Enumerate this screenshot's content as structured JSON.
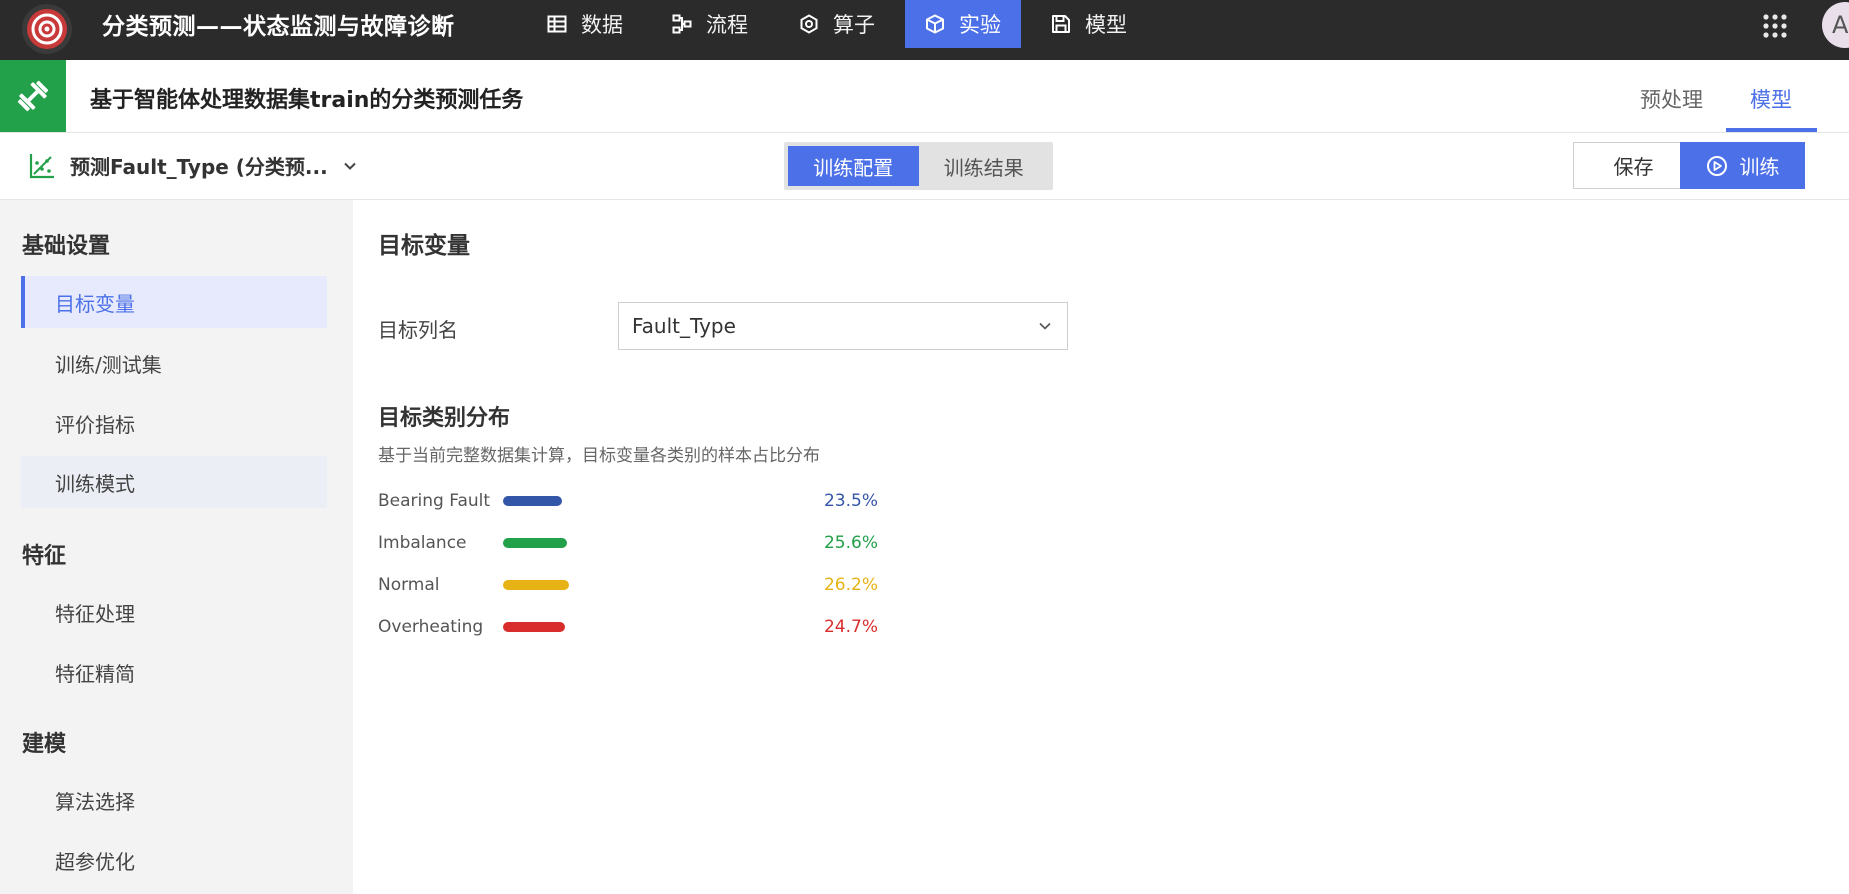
{
  "app": {
    "title": "分类预测——状态监测与故障诊断",
    "avatar_text": "A"
  },
  "topnav": [
    {
      "label": "数据",
      "icon": "table-icon",
      "active": false
    },
    {
      "label": "流程",
      "icon": "flow-icon",
      "active": false
    },
    {
      "label": "算子",
      "icon": "hexagon-gear-icon",
      "active": false
    },
    {
      "label": "实验",
      "icon": "cube-icon",
      "active": true
    },
    {
      "label": "模型",
      "icon": "floppy-disk-icon",
      "active": false
    }
  ],
  "task": {
    "title": "基于智能体处理数据集train的分类预测任务",
    "tabs": [
      {
        "label": "预处理",
        "active": false
      },
      {
        "label": "模型",
        "active": true
      }
    ]
  },
  "toolbar": {
    "model_select": "预测Fault_Type (分类预...",
    "segments": [
      {
        "label": "训练配置",
        "active": true
      },
      {
        "label": "训练结果",
        "active": false
      }
    ],
    "save_label": "保存",
    "train_label": "训练"
  },
  "sidebar": {
    "groups": [
      {
        "title": "基础设置",
        "items": [
          {
            "label": "目标变量",
            "state": "selected"
          },
          {
            "label": "训练/测试集",
            "state": ""
          },
          {
            "label": "评价指标",
            "state": ""
          },
          {
            "label": "训练模式",
            "state": "hover"
          }
        ]
      },
      {
        "title": "特征",
        "items": [
          {
            "label": "特征处理",
            "state": ""
          },
          {
            "label": "特征精简",
            "state": ""
          }
        ]
      },
      {
        "title": "建模",
        "items": [
          {
            "label": "算法选择",
            "state": ""
          },
          {
            "label": "超参优化",
            "state": ""
          }
        ]
      }
    ]
  },
  "main": {
    "section_title": "目标变量",
    "target_label": "目标列名",
    "target_value": "Fault_Type",
    "dist_title": "目标类别分布",
    "dist_desc": "基于当前完整数据集计算，目标变量各类别的样本占比分布",
    "distribution": [
      {
        "label": "Bearing Fault",
        "value": "23.5%",
        "fraction": 0.235,
        "color": "#3456a8"
      },
      {
        "label": "Imbalance",
        "value": "25.6%",
        "fraction": 0.256,
        "color": "#22a04a"
      },
      {
        "label": "Normal",
        "value": "26.2%",
        "fraction": 0.262,
        "color": "#e6b214"
      },
      {
        "label": "Overheating",
        "value": "24.7%",
        "fraction": 0.247,
        "color": "#d92d2d"
      }
    ]
  },
  "colors": {
    "accent": "#4c70e8",
    "topbar": "#2b2b2b",
    "task_icon_bg": "#22a04a"
  }
}
